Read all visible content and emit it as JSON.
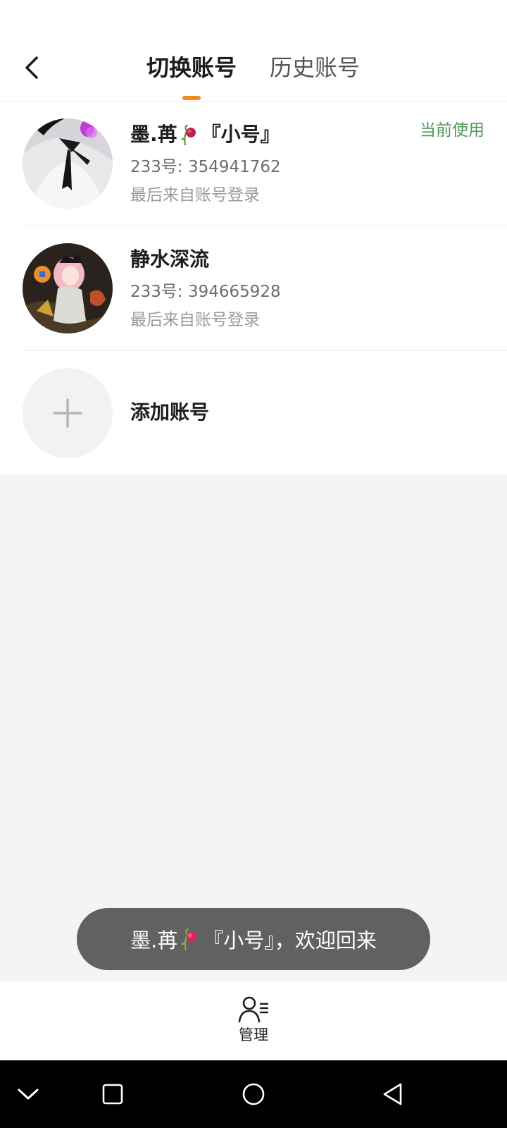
{
  "header": {
    "tabs": [
      {
        "label": "切换账号",
        "active": true
      },
      {
        "label": "历史账号",
        "active": false
      }
    ],
    "accent_color": "#f08a24"
  },
  "accounts": [
    {
      "name_prefix": "墨.苒",
      "name_suffix": "『小号』",
      "id_text": "233号: 354941762",
      "login_text": "最后来自账号登录",
      "badge": "当前使用",
      "avatar_icon": "anime-avatar-white-dress-icon"
    },
    {
      "name": "静水深流",
      "id_text": "233号: 394665928",
      "login_text": "最后来自账号登录",
      "avatar_icon": "anime-avatar-pink-hair-icon"
    }
  ],
  "add_account": {
    "label": "添加账号",
    "icon": "plus-icon"
  },
  "toast": {
    "prefix": "墨.苒",
    "suffix": "『小号』，欢迎回来"
  },
  "bottom_bar": {
    "manage_label": "管理",
    "manage_icon": "user-list-icon"
  },
  "nav_bar": {
    "icons": [
      "chevron-down-icon",
      "square-icon",
      "circle-icon",
      "back-triangle-icon"
    ]
  },
  "colors": {
    "current_badge": "#4f9a5a",
    "toast_bg": "#616161"
  }
}
